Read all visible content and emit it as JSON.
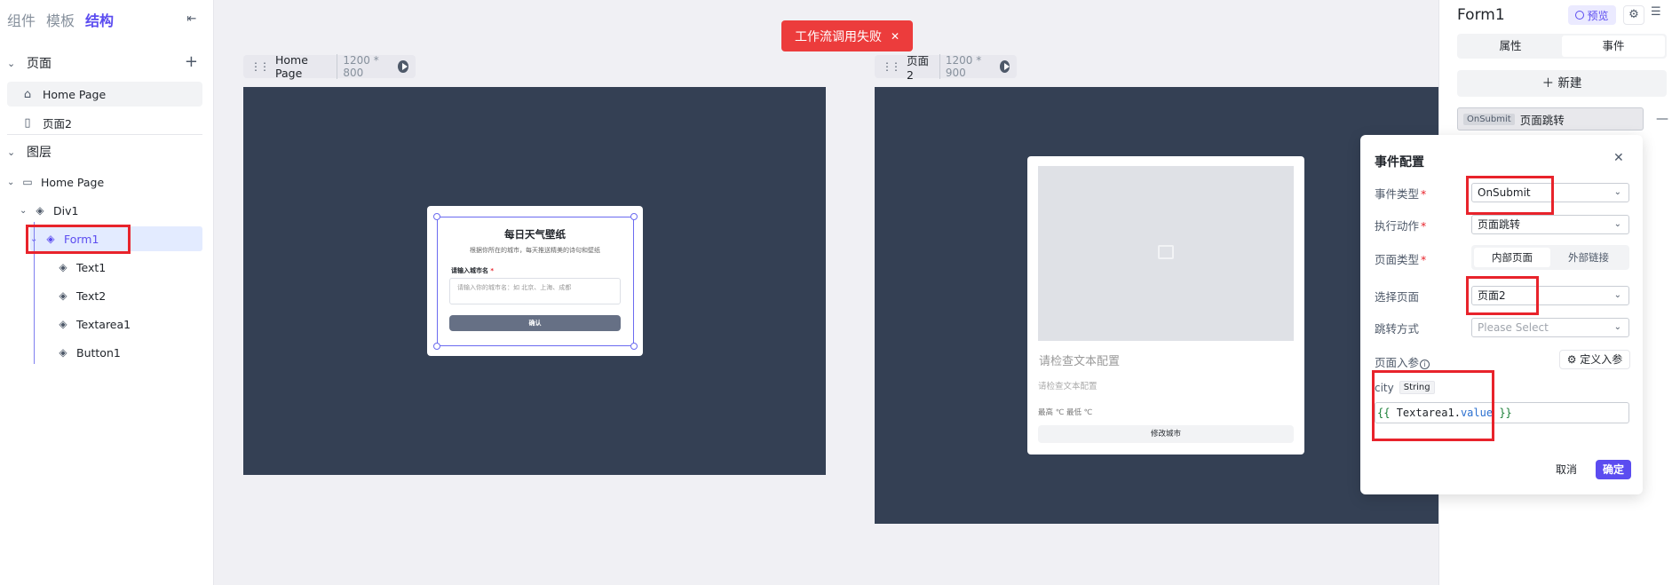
{
  "left_panel": {
    "tabs": [
      "组件",
      "模板",
      "结构"
    ],
    "pages_section": "页面",
    "pages": [
      "Home Page",
      "页面2"
    ],
    "layers_section": "图层",
    "layers": {
      "root": "Home Page",
      "div": "Div1",
      "form": "Form1",
      "children": [
        "Text1",
        "Text2",
        "Textarea1",
        "Button1"
      ]
    }
  },
  "toast": {
    "text": "工作流调用失败"
  },
  "canvas": {
    "frame1": {
      "name": "Home Page",
      "size": "1200 * 800"
    },
    "frame2": {
      "name": "页面2",
      "size": "1200 * 900"
    },
    "form_card": {
      "title": "每日天气壁纸",
      "subtitle": "根据你所在的城市，每天推送精美的诗句和壁纸",
      "field_label": "请输入城市名",
      "placeholder": "请输入你的城市名：如 北京、上海、成都",
      "button": "确认"
    },
    "result_card": {
      "line1": "请检查文本配置",
      "line2": "请检查文本配置",
      "line3": "最高 ℃ 最低 ℃",
      "button": "修改城市"
    }
  },
  "right_panel": {
    "title": "Form1",
    "preview": "预览",
    "tabs": [
      "属性",
      "事件"
    ],
    "new_button": "新建",
    "event_tag": "OnSubmit",
    "event_action": "页面跳转"
  },
  "event_config": {
    "title": "事件配置",
    "event_type_label": "事件类型",
    "event_type_value": "OnSubmit",
    "action_label": "执行动作",
    "action_value": "页面跳转",
    "page_type_label": "页面类型",
    "page_type_options": [
      "内部页面",
      "外部链接"
    ],
    "select_page_label": "选择页面",
    "select_page_value": "页面2",
    "jump_mode_label": "跳转方式",
    "jump_mode_placeholder": "Please Select",
    "params_label": "页面入参",
    "define_params_button": "定义入参",
    "param_name": "city",
    "param_type": "String",
    "expr_open": "{{",
    "expr_obj": "Textarea1",
    "expr_dot": ".",
    "expr_prop": "value",
    "expr_close": "}}",
    "cancel": "取消",
    "confirm": "确定"
  },
  "colors": {
    "accent": "#5b4cf0",
    "error": "#ec3c3c",
    "highlight": "#e8232b",
    "frame_bg": "#344054"
  }
}
